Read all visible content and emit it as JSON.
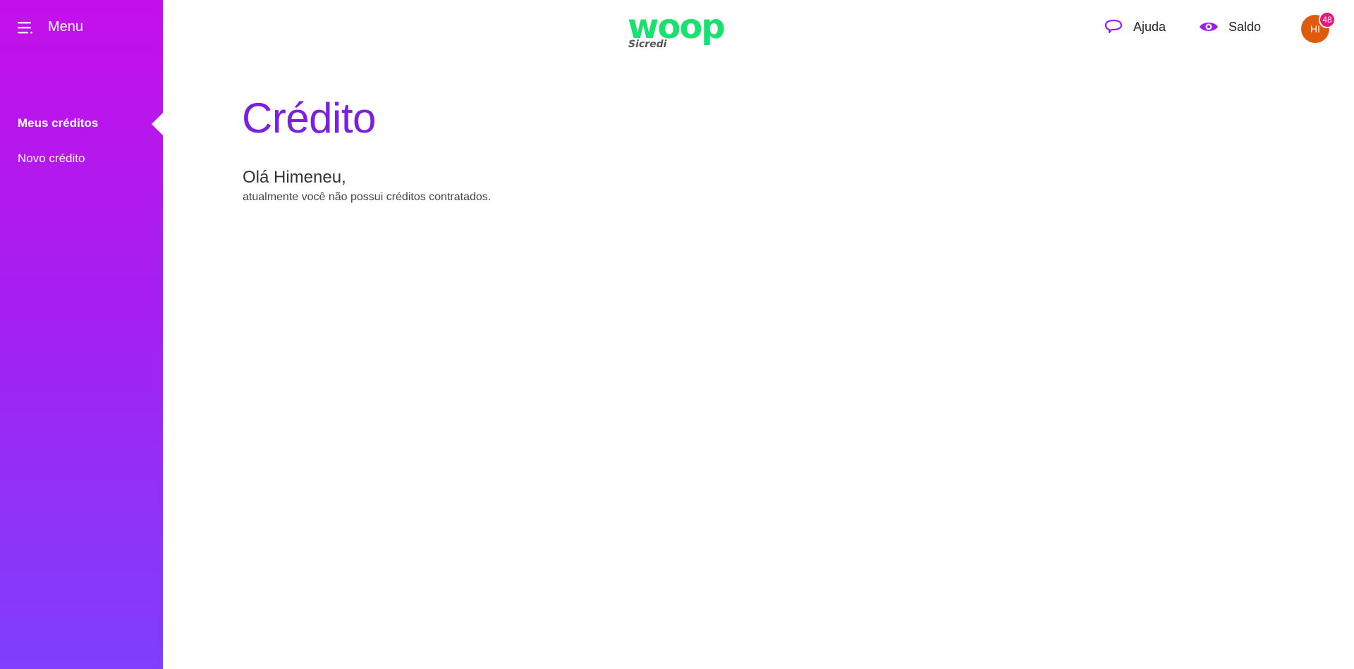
{
  "sidebar": {
    "menu_label": "Menu",
    "items": [
      {
        "label": "Meus créditos",
        "active": true
      },
      {
        "label": "Novo crédito",
        "active": false
      }
    ],
    "gradient_top": "#c410ea",
    "gradient_bottom": "#7f3ffd"
  },
  "header": {
    "logo": {
      "brand": "woop",
      "sub": "Sicredi",
      "color": "#1ae070"
    },
    "help_label": "Ajuda",
    "balance_label": "Saldo",
    "avatar_initials": "HI",
    "notification_count": "48",
    "icons": [
      "menu-icon",
      "chat-bubble-icon",
      "eye-icon"
    ]
  },
  "main": {
    "title": "Crédito",
    "greeting": "Olá Himeneu,",
    "message": "atualmente você não possui créditos contratados."
  },
  "colors": {
    "accent": "#7b1fe0",
    "avatar": "#e05a0c",
    "badge": "#e8157a"
  }
}
